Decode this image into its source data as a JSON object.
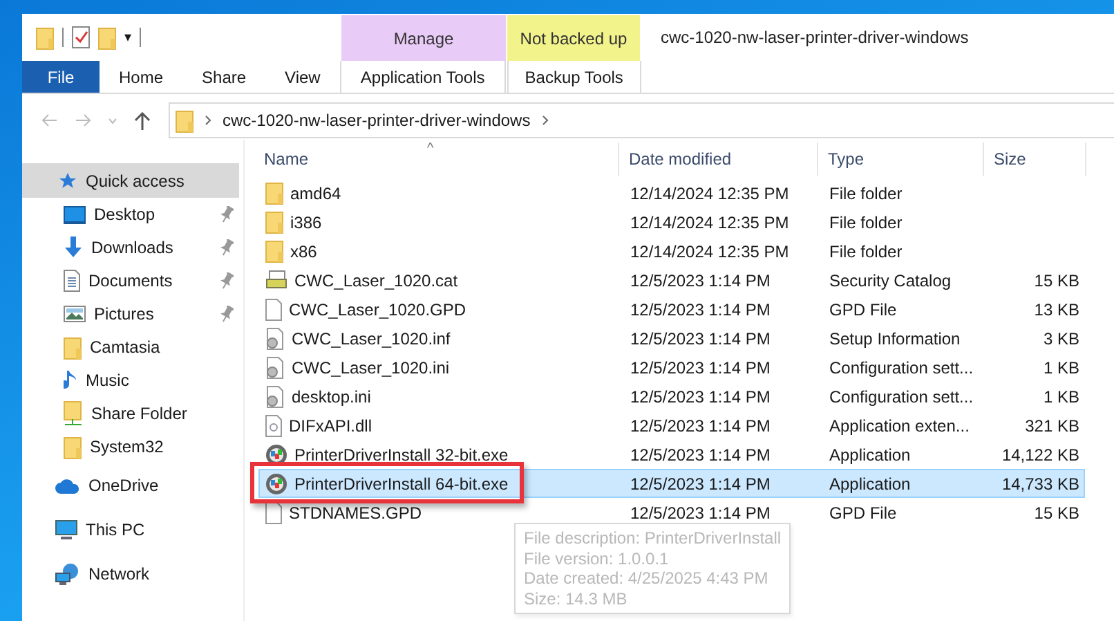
{
  "ribbon": {
    "quick_toolbar": {
      "dropdown": "▾"
    },
    "context_headers": [
      {
        "label": "Manage",
        "color": "#e9cbf7"
      },
      {
        "label": "Not backed up",
        "color": "#f3f38c"
      }
    ],
    "window_title": "cwc-1020-nw-laser-printer-driver-windows",
    "tabs": [
      {
        "label": "File",
        "kind": "file",
        "selected": false
      },
      {
        "label": "Home",
        "kind": "plain",
        "selected": false
      },
      {
        "label": "Share",
        "kind": "plain",
        "selected": false
      },
      {
        "label": "View",
        "kind": "plain",
        "selected": false
      },
      {
        "label": "Application Tools",
        "kind": "context",
        "selected": false
      },
      {
        "label": "Backup Tools",
        "kind": "context",
        "selected": false
      }
    ]
  },
  "address_bar": {
    "path": [
      "cwc-1020-nw-laser-printer-driver-windows"
    ]
  },
  "sidebar": {
    "items": [
      {
        "label": "Quick access",
        "kind": "quick",
        "selected": true,
        "children": [
          {
            "label": "Desktop",
            "kind": "desktop",
            "pinned": true
          },
          {
            "label": "Downloads",
            "kind": "downloads",
            "pinned": true
          },
          {
            "label": "Documents",
            "kind": "documents",
            "pinned": true
          },
          {
            "label": "Pictures",
            "kind": "pictures",
            "pinned": true
          },
          {
            "label": "Camtasia",
            "kind": "folder",
            "pinned": false
          },
          {
            "label": "Music",
            "kind": "music",
            "pinned": false
          },
          {
            "label": "Share Folder",
            "kind": "share",
            "pinned": false
          },
          {
            "label": "System32",
            "kind": "folder",
            "pinned": false
          }
        ]
      },
      {
        "label": "OneDrive",
        "kind": "cloud",
        "selected": false
      },
      {
        "label": "This PC",
        "kind": "pc",
        "selected": false
      },
      {
        "label": "Network",
        "kind": "network",
        "selected": false
      }
    ]
  },
  "table": {
    "sort_indicator": "^",
    "columns": [
      "Name",
      "Date modified",
      "Type",
      "Size"
    ],
    "rows": [
      {
        "kind": "folder",
        "name": "amd64",
        "date": "12/14/2024 12:35 PM",
        "type": "File folder",
        "selected": false,
        "outlined": false
      },
      {
        "kind": "folder",
        "name": "i386",
        "date": "12/14/2024 12:35 PM",
        "type": "File folder",
        "selected": false,
        "outlined": false
      },
      {
        "kind": "folder",
        "name": "x86",
        "date": "12/14/2024 12:35 PM",
        "type": "File folder",
        "selected": false,
        "outlined": false
      },
      {
        "kind": "catalog",
        "name": "CWC_Laser_1020.cat",
        "date": "12/5/2023 1:14 PM",
        "type": "Security Catalog",
        "size": "15 KB",
        "selected": false,
        "outlined": false
      },
      {
        "kind": "document",
        "name": "CWC_Laser_1020.GPD",
        "date": "12/5/2023 1:14 PM",
        "type": "GPD File",
        "size": "13 KB",
        "selected": false,
        "outlined": false
      },
      {
        "kind": "settings",
        "name": "CWC_Laser_1020.inf",
        "date": "12/5/2023 1:14 PM",
        "type": "Setup Information",
        "size": "3 KB",
        "selected": false,
        "outlined": false
      },
      {
        "kind": "settings",
        "name": "CWC_Laser_1020.ini",
        "date": "12/5/2023 1:14 PM",
        "type": "Configuration sett...",
        "size": "1 KB",
        "selected": false,
        "outlined": false
      },
      {
        "kind": "settings",
        "name": "desktop.ini",
        "date": "12/5/2023 1:14 PM",
        "type": "Configuration sett...",
        "size": "1 KB",
        "selected": false,
        "outlined": false
      },
      {
        "kind": "library",
        "name": "DIFxAPI.dll",
        "date": "12/5/2023 1:14 PM",
        "type": "Application exten...",
        "size": "321 KB",
        "selected": false,
        "outlined": false
      },
      {
        "kind": "installer",
        "name": "PrinterDriverInstall 32-bit.exe",
        "date": "12/5/2023 1:14 PM",
        "type": "Application",
        "size": "14,122 KB",
        "selected": false,
        "outlined": false
      },
      {
        "kind": "installer",
        "name": "PrinterDriverInstall 64-bit.exe",
        "date": "12/5/2023 1:14 PM",
        "type": "Application",
        "size": "14,733 KB",
        "selected": true,
        "outlined": true
      },
      {
        "kind": "document",
        "name": "STDNAMES.GPD",
        "date": "12/5/2023 1:14 PM",
        "type": "GPD File",
        "size": "15 KB",
        "selected": false,
        "outlined": false
      }
    ]
  },
  "tooltip": {
    "lines": [
      "File description: PrinterDriverInstall",
      "File version: 1.0.0.1",
      "Date created: 4/25/2025 4:43 PM",
      "Size: 14.3 MB"
    ]
  }
}
